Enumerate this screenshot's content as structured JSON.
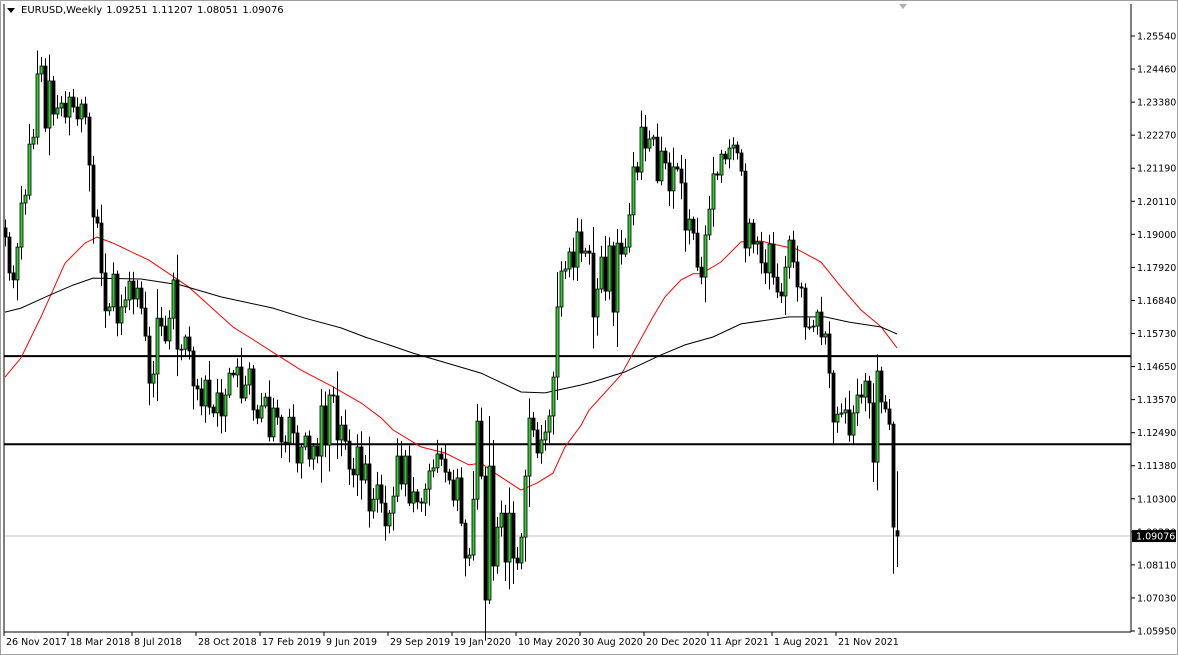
{
  "header": {
    "symbol_timeframe": "EURUSD,Weekly",
    "open": "1.09251",
    "high": "1.11207",
    "low": "1.08051",
    "close": "1.09076"
  },
  "current_price_label": "1.09076",
  "colors": {
    "bull_fill": "#33cc33",
    "bear_fill": "#000000",
    "fast_ma": "#ff0000",
    "slow_ma": "#000000",
    "level_line": "#000000",
    "current_price_line": "#c0c0c0"
  },
  "chart_data": {
    "type": "candlestick",
    "title": "EURUSD,Weekly",
    "ylim": [
      1.0595,
      1.2554
    ],
    "grid": false,
    "y_ticks": [
      "1.25540",
      "1.24460",
      "1.23380",
      "1.22270",
      "1.21190",
      "1.20110",
      "1.19000",
      "1.17920",
      "1.16840",
      "1.15730",
      "1.14650",
      "1.13570",
      "1.12490",
      "1.11380",
      "1.10300",
      "1.09220",
      "1.08110",
      "1.07030",
      "1.05950"
    ],
    "x_ticks": [
      {
        "index": 0,
        "label": "26 Nov 2017"
      },
      {
        "index": 16,
        "label": "18 Mar 2018"
      },
      {
        "index": 32,
        "label": "8 Jul 2018"
      },
      {
        "index": 48,
        "label": "28 Oct 2018"
      },
      {
        "index": 64,
        "label": "17 Feb 2019"
      },
      {
        "index": 80,
        "label": "9 Jun 2019"
      },
      {
        "index": 96,
        "label": "29 Sep 2019"
      },
      {
        "index": 112,
        "label": "19 Jan 2020"
      },
      {
        "index": 128,
        "label": "10 May 2020"
      },
      {
        "index": 144,
        "label": "30 Aug 2020"
      },
      {
        "index": 160,
        "label": "20 Dec 2020"
      },
      {
        "index": 176,
        "label": "11 Apr 2021"
      },
      {
        "index": 192,
        "label": "1 Aug 2021"
      },
      {
        "index": 208,
        "label": "21 Nov 2021"
      }
    ],
    "closes": [
      1.1892,
      1.1774,
      1.1751,
      1.1859,
      1.2004,
      1.203,
      1.2198,
      1.2221,
      1.2429,
      1.2455,
      1.2251,
      1.2406,
      1.2297,
      1.2317,
      1.2333,
      1.2287,
      1.2353,
      1.232,
      1.2281,
      1.233,
      1.2287,
      1.2129,
      1.1958,
      1.1938,
      1.1774,
      1.1649,
      1.1662,
      1.177,
      1.1609,
      1.1662,
      1.1685,
      1.1747,
      1.1688,
      1.1724,
      1.1658,
      1.1566,
      1.1411,
      1.1441,
      1.1625,
      1.1599,
      1.155,
      1.1625,
      1.1751,
      1.1523,
      1.1523,
      1.1563,
      1.1517,
      1.1402,
      1.1392,
      1.1336,
      1.1421,
      1.1332,
      1.1313,
      1.1379,
      1.1303,
      1.1372,
      1.1444,
      1.1438,
      1.1464,
      1.1362,
      1.1405,
      1.1458,
      1.1323,
      1.1296,
      1.1336,
      1.1365,
      1.1234,
      1.1329,
      1.1299,
      1.1217,
      1.1214,
      1.1299,
      1.1247,
      1.1148,
      1.1201,
      1.1237,
      1.1161,
      1.1204,
      1.1171,
      1.1336,
      1.1207,
      1.1372,
      1.1369,
      1.1224,
      1.1273,
      1.122,
      1.1128,
      1.1109,
      1.1201,
      1.1092,
      1.1145,
      1.099,
      1.1029,
      1.1076,
      1.1016,
      1.0941,
      1.0983,
      1.1039,
      1.1171,
      1.1079,
      1.1171,
      1.1016,
      1.1053,
      1.102,
      1.1016,
      1.1062,
      1.1122,
      1.1132,
      1.1178,
      1.1161,
      1.1118,
      1.1092,
      1.1026,
      1.1099,
      1.095,
      1.0835,
      1.0845,
      1.1029,
      1.1286,
      1.1105,
      1.0697,
      1.1138,
      1.0809,
      1.0937,
      1.0983,
      1.0822,
      1.0983,
      1.0835,
      1.0819,
      1.0904,
      1.1105,
      1.1296,
      1.1257,
      1.1181,
      1.1224,
      1.125,
      1.1303,
      1.1431,
      1.1662,
      1.178,
      1.1787,
      1.1843,
      1.1793,
      1.1909,
      1.1839,
      1.1846,
      1.1839,
      1.1629,
      1.1721,
      1.1826,
      1.1714,
      1.1863,
      1.1645,
      1.1872,
      1.1836,
      1.1859,
      1.1965,
      1.2123,
      1.2106,
      1.2254,
      1.2185,
      1.2215,
      1.2221,
      1.2077,
      1.2175,
      1.2136,
      1.2044,
      1.2123,
      1.2116,
      1.207,
      1.1915,
      1.1951,
      1.1905,
      1.1793,
      1.176,
      1.1899,
      1.1984,
      1.21,
      1.2096,
      1.2165,
      1.2149,
      1.2185,
      1.2195,
      1.2169,
      1.2109,
      1.1856,
      1.1938,
      1.1869,
      1.1876,
      1.1807,
      1.1774,
      1.1869,
      1.176,
      1.1711,
      1.1698,
      1.1793,
      1.1882,
      1.181,
      1.1728,
      1.1724,
      1.1596,
      1.1596,
      1.1599,
      1.1645,
      1.1563,
      1.1573,
      1.1444,
      1.1283,
      1.1309,
      1.1313,
      1.1323,
      1.124,
      1.1313,
      1.1372,
      1.1365,
      1.1418,
      1.1346,
      1.1151,
      1.1451,
      1.1349,
      1.1326,
      1.1276,
      1.0937,
      1.09076
    ],
    "last_candle": {
      "open": 1.09251,
      "high": 1.11207,
      "low": 1.08051,
      "close": 1.09076
    },
    "moving_averages": [
      {
        "name": "fast MA (red)",
        "color": "#ff0000",
        "points": [
          [
            0,
            1.1431
          ],
          [
            4,
            1.1494
          ],
          [
            9,
            1.1629
          ],
          [
            15,
            1.1806
          ],
          [
            20,
            1.1872
          ],
          [
            23,
            1.1892
          ],
          [
            27,
            1.1872
          ],
          [
            36,
            1.1816
          ],
          [
            46,
            1.1727
          ],
          [
            49,
            1.1691
          ],
          [
            57,
            1.1596
          ],
          [
            61,
            1.1563
          ],
          [
            68,
            1.1504
          ],
          [
            74,
            1.1454
          ],
          [
            82,
            1.1399
          ],
          [
            89,
            1.1346
          ],
          [
            94,
            1.1297
          ],
          [
            97,
            1.1257
          ],
          [
            104,
            1.1201
          ],
          [
            110,
            1.1181
          ],
          [
            116,
            1.1142
          ],
          [
            119,
            1.1148
          ],
          [
            122,
            1.1119
          ],
          [
            129,
            1.1059
          ],
          [
            133,
            1.1082
          ],
          [
            137,
            1.1115
          ],
          [
            140,
            1.1201
          ],
          [
            144,
            1.1272
          ],
          [
            146,
            1.1322
          ],
          [
            154,
            1.1438
          ],
          [
            157,
            1.151
          ],
          [
            162,
            1.1629
          ],
          [
            165,
            1.1695
          ],
          [
            169,
            1.1751
          ],
          [
            172,
            1.1771
          ],
          [
            174,
            1.1771
          ],
          [
            179,
            1.181
          ],
          [
            184,
            1.1876
          ],
          [
            189,
            1.1879
          ],
          [
            191,
            1.1872
          ],
          [
            198,
            1.1852
          ],
          [
            204,
            1.181
          ],
          [
            209,
            1.1728
          ],
          [
            214,
            1.1652
          ],
          [
            219,
            1.1597
          ],
          [
            223,
            1.1527
          ]
        ]
      },
      {
        "name": "slow MA (black)",
        "color": "#000000",
        "points": [
          [
            0,
            1.1645
          ],
          [
            4,
            1.1658
          ],
          [
            11,
            1.17
          ],
          [
            17,
            1.1734
          ],
          [
            22,
            1.1757
          ],
          [
            34,
            1.1754
          ],
          [
            44,
            1.1734
          ],
          [
            54,
            1.1695
          ],
          [
            67,
            1.1658
          ],
          [
            75,
            1.1625
          ],
          [
            84,
            1.1593
          ],
          [
            90,
            1.1563
          ],
          [
            96,
            1.1537
          ],
          [
            102,
            1.151
          ],
          [
            119,
            1.1444
          ],
          [
            129,
            1.1382
          ],
          [
            135,
            1.1379
          ],
          [
            144,
            1.1405
          ],
          [
            147,
            1.1415
          ],
          [
            155,
            1.1448
          ],
          [
            164,
            1.1504
          ],
          [
            170,
            1.1537
          ],
          [
            177,
            1.1563
          ],
          [
            184,
            1.1606
          ],
          [
            196,
            1.1629
          ],
          [
            205,
            1.1629
          ],
          [
            211,
            1.1612
          ],
          [
            219,
            1.1596
          ],
          [
            223,
            1.1573
          ]
        ]
      }
    ],
    "horizontal_levels": [
      1.15,
      1.121
    ],
    "current_price": 1.09076
  }
}
